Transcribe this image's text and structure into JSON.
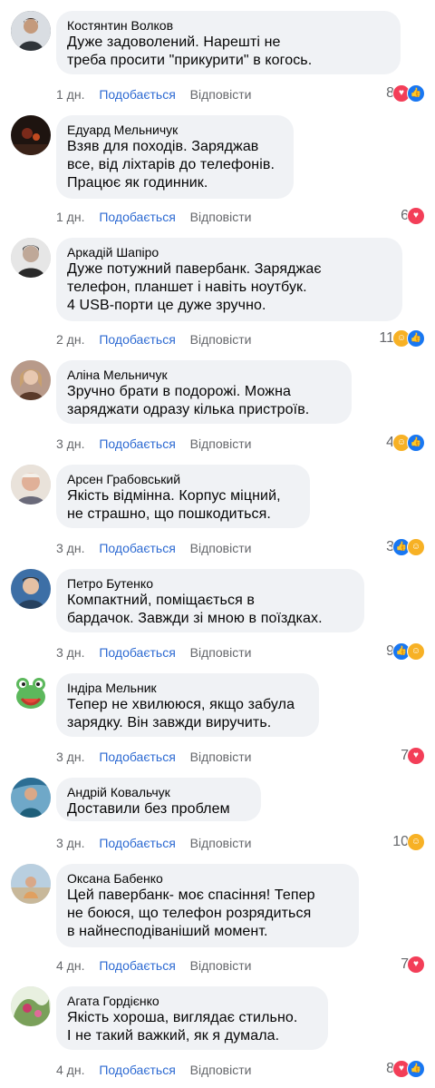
{
  "comments": [
    {
      "author": "Костянтин Волков",
      "text": "Дуже задоволений. Нарешті не\nтреба просити \"прикурити\" в когось.",
      "time": "1 дн.",
      "like_label": "Подобається",
      "reply_label": "Відповісти",
      "reaction_count": "8",
      "reactions": [
        "love-reaction-icon",
        "like-reaction-icon"
      ],
      "avatar_color": "#4a4f55"
    },
    {
      "author": "Едуард Мельничук",
      "text": "Взяв для походів. Заряджав\nвсе, від ліхтарів до телефонів.\nПрацює як годинник.",
      "time": "1 дн.",
      "like_label": "Подобається",
      "reply_label": "Відповісти",
      "reaction_count": "6",
      "reactions": [
        "love-reaction-icon"
      ],
      "avatar_color": "#2b1a14"
    },
    {
      "author": "Аркадій Шапіро",
      "text": "Дуже потужний павербанк. Заряджає\nтелефон, планшет і навіть ноутбук.\n4 USB-порти це дуже зручно.",
      "time": "2 дн.",
      "like_label": "Подобається",
      "reply_label": "Відповісти",
      "reaction_count": "11",
      "reactions": [
        "care-reaction-icon",
        "like-reaction-icon"
      ],
      "avatar_color": "#3a3a3a"
    },
    {
      "author": "Аліна Мельничук",
      "text": "Зручно брати в подорожі. Можна\nзаряджати одразу кілька пристроїв.",
      "time": "3 дн.",
      "like_label": "Подобається",
      "reply_label": "Відповісти",
      "reaction_count": "4",
      "reactions": [
        "care-reaction-icon",
        "like-reaction-icon"
      ],
      "avatar_color": "#8a6a5a"
    },
    {
      "author": "Арсен Грабовський",
      "text": "Якість відмінна. Корпус міцний,\nне страшно, що пошкодиться.",
      "time": "3 дн.",
      "like_label": "Подобається",
      "reply_label": "Відповісти",
      "reaction_count": "3",
      "reactions": [
        "like-reaction-icon",
        "care-reaction-icon"
      ],
      "avatar_color": "#c9a58a"
    },
    {
      "author": "Петро Бутенко",
      "text": "Компактний, поміщається в\nбардачок. Завжди зі мною в поїздках.",
      "time": "3 дн.",
      "like_label": "Подобається",
      "reply_label": "Відповісти",
      "reaction_count": "9",
      "reactions": [
        "like-reaction-icon",
        "care-reaction-icon"
      ],
      "avatar_color": "#4a7bb0"
    },
    {
      "author": "Індіра Мельник",
      "text": "Тепер не хвилююся, якщо забула\nзарядку. Він завжди виручить.",
      "time": "3 дн.",
      "like_label": "Подобається",
      "reply_label": "Відповісти",
      "reaction_count": "7",
      "reactions": [
        "love-reaction-icon"
      ],
      "avatar_color": "#5cb85c"
    },
    {
      "author": "Андрій Ковальчук",
      "text": "Доставили без проблем",
      "time": "3 дн.",
      "like_label": "Подобається",
      "reply_label": "Відповісти",
      "reaction_count": "10",
      "reactions": [
        "care-reaction-icon"
      ],
      "avatar_color": "#3b7fa8"
    },
    {
      "author": "Оксана Бабенко",
      "text": "Цей павербанк- моє спасіння! Тепер\nне боюся, що телефон розрядиться\nв найнесподіваніший момент.",
      "time": "4 дн.",
      "like_label": "Подобається",
      "reply_label": "Відповісти",
      "reaction_count": "7",
      "reactions": [
        "love-reaction-icon"
      ],
      "avatar_color": "#9bb0c4"
    },
    {
      "author": "Агата Гордієнко",
      "text": "Якість хороша, виглядає стильно.\nІ не такий важкий, як я думала.",
      "time": "4 дн.",
      "like_label": "Подобається",
      "reply_label": "Відповісти",
      "reaction_count": "8",
      "reactions": [
        "love-reaction-icon",
        "like-reaction-icon"
      ],
      "avatar_color": "#7aa05a"
    }
  ],
  "colors": {
    "like_blue": "#1877f2",
    "love_red": "#f33e58",
    "care_yellow": "#f7b125",
    "action_text": "#65676b",
    "action_like_text": "#2d6ad2",
    "bubble_bg": "#f0f2f5"
  }
}
